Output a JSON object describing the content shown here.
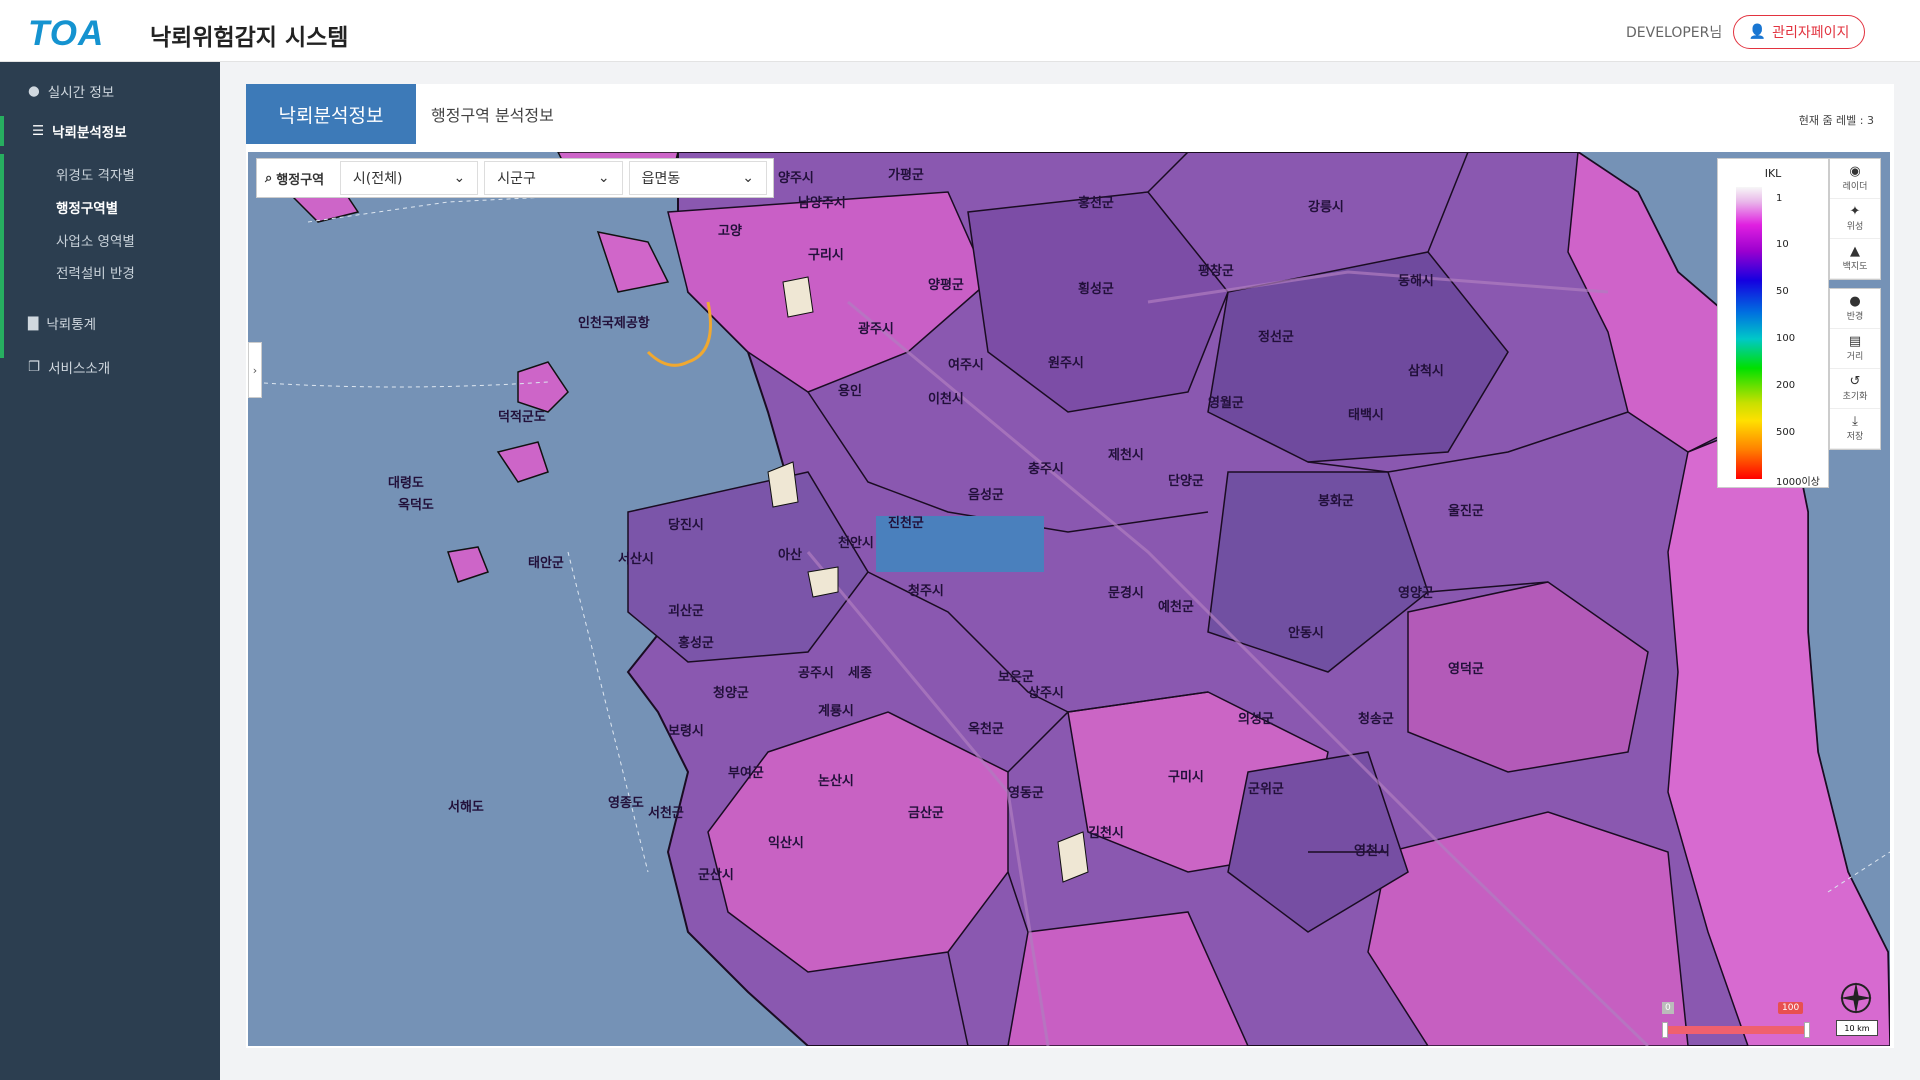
{
  "header": {
    "logo": "TOA",
    "app_title": "낙뢰위험감지 시스템",
    "user": "DEVELOPER님",
    "admin_button": "관리자페이지"
  },
  "sidebar": {
    "items": [
      {
        "label": "실시간 정보",
        "icon": "map-pin-icon"
      },
      {
        "label": "낙뢰분석정보",
        "icon": "document-icon"
      },
      {
        "label": "낙뢰통계",
        "icon": "bar-chart-icon"
      },
      {
        "label": "서비스소개",
        "icon": "copy-icon"
      }
    ],
    "subitems": [
      "위경도 격자별",
      "행정구역별",
      "사업소 영역별",
      "전력설비 반경"
    ],
    "active_subitem": "행정구역별"
  },
  "content": {
    "tab_active": "낙뢰분석정보",
    "tab_inactive": "행정구역 분석정보",
    "zoom_level": "현재 줌 레벨 : 3"
  },
  "filter": {
    "label": "행정구역",
    "selects": [
      "시(전체)",
      "시군구",
      "읍면동"
    ]
  },
  "legend": {
    "title": "IKL",
    "ticks": [
      "1",
      "10",
      "50",
      "100",
      "200",
      "500",
      "1000이상"
    ]
  },
  "tools": {
    "group1": [
      {
        "label": "레이더",
        "icon": "radar-icon"
      },
      {
        "label": "위성",
        "icon": "satellite-icon"
      },
      {
        "label": "백지도",
        "icon": "blank-map-icon"
      }
    ],
    "group2": [
      {
        "label": "반경",
        "icon": "radius-icon"
      },
      {
        "label": "거리",
        "icon": "ruler-icon"
      },
      {
        "label": "초기화",
        "icon": "reset-icon"
      },
      {
        "label": "저장",
        "icon": "download-icon"
      }
    ]
  },
  "map": {
    "labels": [
      "양주시",
      "가평군",
      "홍천군",
      "강릉시",
      "남양주시",
      "구리시",
      "고양",
      "인천국제공항",
      "양평군",
      "횡성군",
      "평창군",
      "동해시",
      "광주시",
      "여주시",
      "원주시",
      "정선군",
      "삼척시",
      "이천시",
      "용인",
      "영월군",
      "태백시",
      "제천시",
      "단양군",
      "충주시",
      "음성군",
      "당진시",
      "아산",
      "천안시",
      "진천군",
      "봉화군",
      "울진군",
      "서산시",
      "태안군",
      "문경시",
      "예천군",
      "영양군",
      "안동시",
      "홍성군",
      "공주시",
      "세종",
      "보령시",
      "상주시",
      "의성군",
      "청송군",
      "영덕군",
      "논산시",
      "계룡시",
      "옥천군",
      "구미시",
      "군위군",
      "익산시",
      "금산군",
      "영동군",
      "김천시",
      "영천시",
      "군산시",
      "부여군",
      "서천군",
      "대령도",
      "옥덕도",
      "덕적군도",
      "청양군",
      "보은군",
      "청주시",
      "영종도",
      "서해도",
      "괴산군"
    ],
    "range_min": "0",
    "range_max": "100",
    "scale_text": "10 km"
  },
  "colors": {
    "accent": "#3d7ab8",
    "sidebar_bg": "#2c3e50",
    "sidebar_active": "#27ae60",
    "admin": "#e2333f",
    "sea": "#6f8db0",
    "region_pink": "#cf5fc9",
    "region_purple": "#7e55a8"
  }
}
